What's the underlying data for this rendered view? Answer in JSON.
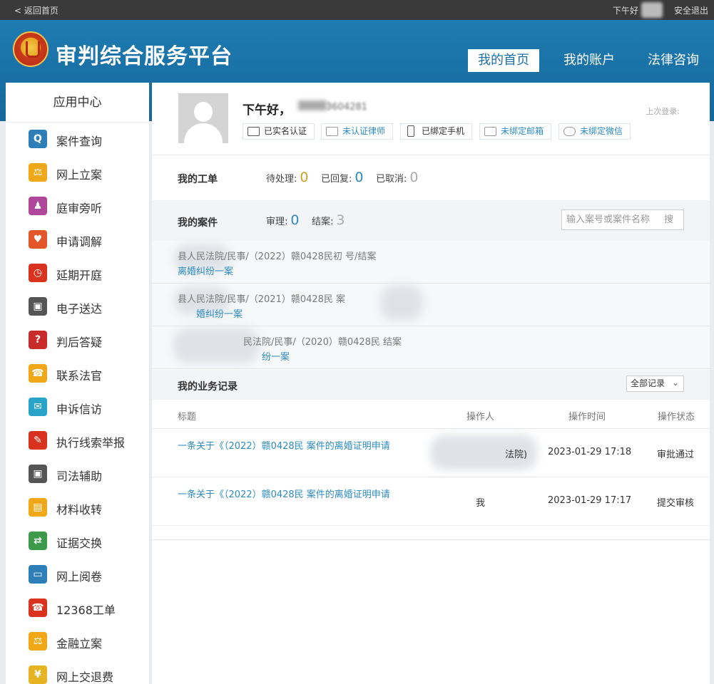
{
  "topbar": {
    "back_label": "< 返回首页",
    "greeting": "下午好",
    "logout_label": "安全退出"
  },
  "header": {
    "title": "审判综合服务平台",
    "nav": [
      "我的首页",
      "我的账户",
      "法律咨询"
    ]
  },
  "sidebar": {
    "title": "应用中心",
    "items": [
      {
        "label": "案件查询",
        "icon": "search-icon",
        "color": "#2e7fb8"
      },
      {
        "label": "网上立案",
        "icon": "gavel-icon",
        "color": "#f0a818"
      },
      {
        "label": "庭审旁听",
        "icon": "people-icon",
        "color": "#b0479b"
      },
      {
        "label": "申请调解",
        "icon": "heart-icon",
        "color": "#e2562a"
      },
      {
        "label": "延期开庭",
        "icon": "clock-icon",
        "color": "#d9331f"
      },
      {
        "label": "电子送达",
        "icon": "camera-icon",
        "color": "#555555"
      },
      {
        "label": "判后答疑",
        "icon": "question-icon",
        "color": "#c92b2b"
      },
      {
        "label": "联系法官",
        "icon": "phone-icon",
        "color": "#f0a818"
      },
      {
        "label": "申诉信访",
        "icon": "mail-icon",
        "color": "#2aa3c9"
      },
      {
        "label": "执行线索举报",
        "icon": "report-icon",
        "color": "#d9331f"
      },
      {
        "label": "司法辅助",
        "icon": "camera-icon",
        "color": "#555555"
      },
      {
        "label": "材料收转",
        "icon": "folder-icon",
        "color": "#f0a818"
      },
      {
        "label": "证据交换",
        "icon": "exchange-icon",
        "color": "#3c9a4a"
      },
      {
        "label": "网上阅卷",
        "icon": "monitor-icon",
        "color": "#2e7fb8"
      },
      {
        "label": "12368工单",
        "icon": "phone-icon",
        "color": "#d9331f"
      },
      {
        "label": "金融立案",
        "icon": "gavel-icon",
        "color": "#f0a818"
      },
      {
        "label": "网上交退费",
        "icon": "coin-icon",
        "color": "#e6b422"
      }
    ]
  },
  "profile": {
    "greeting": "下午好，",
    "id_partial": "3604281",
    "last_login_label": "上次登录:",
    "badges": [
      {
        "label": "已实名认证",
        "state": "on",
        "icon": "id-card-icon"
      },
      {
        "label": "未认证律师",
        "state": "off",
        "icon": "id-card-icon"
      },
      {
        "label": "已绑定手机",
        "state": "on",
        "icon": "phone-icon"
      },
      {
        "label": "未绑定邮箱",
        "state": "off",
        "icon": "mail-icon"
      },
      {
        "label": "未绑定微信",
        "state": "off",
        "icon": "wechat-icon"
      }
    ]
  },
  "work_orders": {
    "title": "我的工单",
    "pending_label": "待处理:",
    "pending": "0",
    "replied_label": "已回复:",
    "replied": "0",
    "cancelled_label": "已取消:",
    "cancelled": "0"
  },
  "cases": {
    "title": "我的案件",
    "trial_label": "审理:",
    "trial": "0",
    "closed_label": "结案:",
    "closed": "3",
    "search_placeholder": "输入案号或案件名称",
    "search_button": "搜",
    "rows": [
      {
        "line1": "县人民法院/民事/（2022）赣0428民初    号/结案",
        "line2": "离婚纠纷一案"
      },
      {
        "line1": "县人民法院/民事/（2021）赣0428民   案",
        "line2": "婚纠纷一案"
      },
      {
        "line1": "民法院/民事/（2020）赣0428民   结案",
        "line2": "纷一案"
      }
    ]
  },
  "records": {
    "title": "我的业务记录",
    "filter": "全部记录",
    "columns": [
      "标题",
      "操作人",
      "操作时间",
      "操作状态"
    ],
    "rows": [
      {
        "title": "一条关于《（2022）赣0428民          案件的离婚证明申请",
        "operator": "法院)",
        "time": "2023-01-29 17:18",
        "status": "审批通过"
      },
      {
        "title": "一条关于《（2022）赣0428民          案件的离婚证明申请",
        "operator": "我",
        "time": "2023-01-29 17:17",
        "status": "提交审核"
      }
    ]
  }
}
